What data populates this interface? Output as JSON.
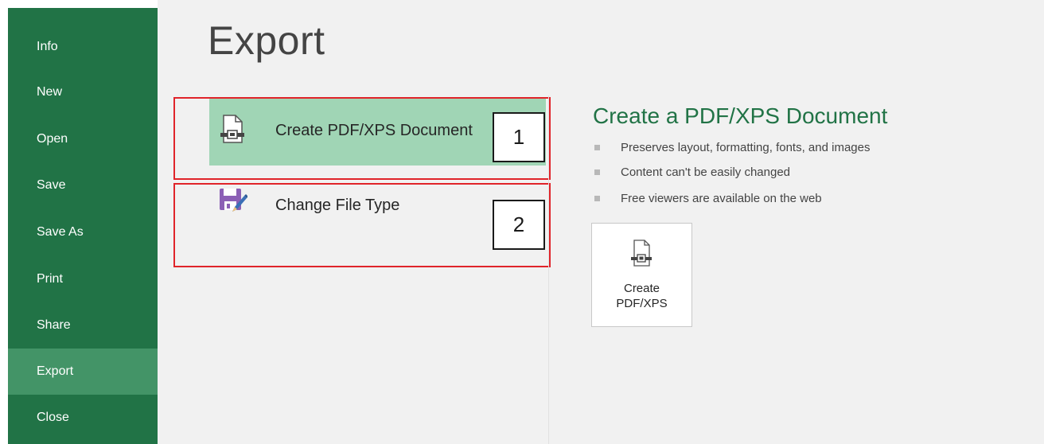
{
  "sidebar": {
    "items": [
      {
        "label": "Info"
      },
      {
        "label": "New"
      },
      {
        "label": "Open"
      },
      {
        "label": "Save"
      },
      {
        "label": "Save As"
      },
      {
        "label": "Print"
      },
      {
        "label": "Share"
      },
      {
        "label": "Export",
        "active": true
      },
      {
        "label": "Close"
      }
    ],
    "background": "#217346",
    "active_background": "#439467"
  },
  "main": {
    "title": "Export",
    "options": [
      {
        "label": "Create PDF/XPS Document",
        "icon": "pdf-document-icon",
        "selected": true
      },
      {
        "label": "Change File Type",
        "icon": "save-edit-icon",
        "selected": false
      }
    ],
    "annotations": [
      {
        "number": "1"
      },
      {
        "number": "2"
      }
    ]
  },
  "detail": {
    "title": "Create a PDF/XPS Document",
    "bullets": [
      "Preserves layout, formatting, fonts, and images",
      "Content can't be easily changed",
      "Free viewers are available on the web"
    ],
    "button": {
      "label_line1": "Create",
      "label_line2": "PDF/XPS",
      "icon": "pdf-document-icon"
    }
  },
  "colors": {
    "accent": "#217346",
    "selected_option": "#a0d5b5",
    "annotation_border": "#e0242a",
    "change_file_icon": "#8b5fb5"
  }
}
